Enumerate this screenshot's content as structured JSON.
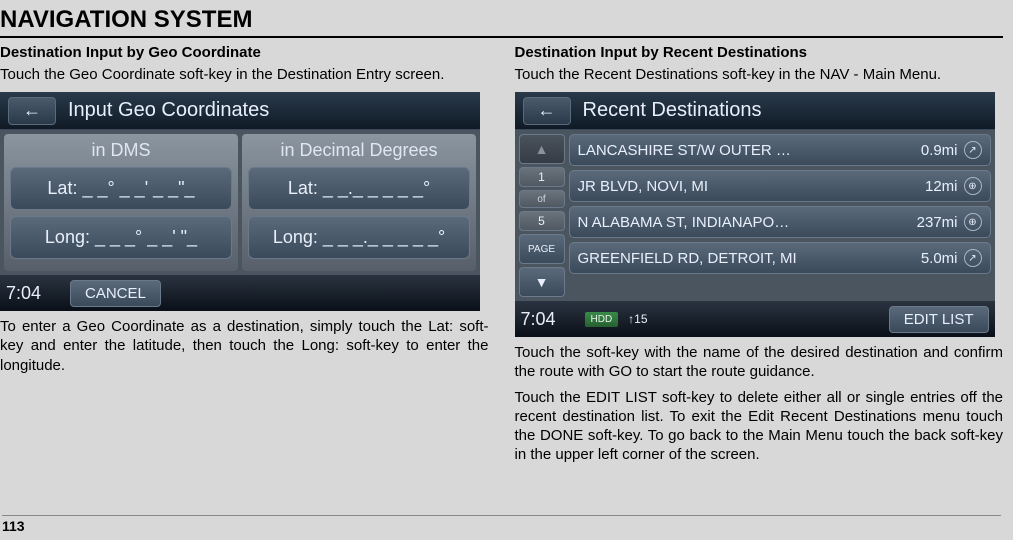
{
  "page_title": "NAVIGATION SYSTEM",
  "page_number": "113",
  "left": {
    "heading": "Destination Input by Geo Coordinate",
    "intro": "Touch the  Geo Coordinate soft-key in the Destination Entry screen.",
    "screen": {
      "back_icon": "←",
      "header_title": "Input Geo Coordinates",
      "dms_title": "in DMS",
      "dec_title": "in Decimal Degrees",
      "dms_lat": "Lat: _ _°  _ _'  _ _\"_",
      "dms_long": "Long: _ _ _°  _ _'   \"_",
      "dec_lat": "Lat: _ _._ _ _ _ _°",
      "dec_long": "Long: _ _ _._ _ _ _ _°",
      "time": "7:04",
      "cancel": "CANCEL"
    },
    "body": "To enter a Geo Coordinate as a destination, simply touch the Lat: soft-key and enter the latitude, then touch the Long: soft-key to enter the longitude."
  },
  "right": {
    "heading": "Destination Input by Recent Destinations",
    "intro": "Touch the Recent Destinations soft-key in the NAV - Main  Menu.",
    "screen": {
      "back_icon": "←",
      "header_title": "Recent Destinations",
      "pager_top": "1",
      "pager_of": "of",
      "pager_bot": "5",
      "pager_page": "PAGE",
      "items": [
        {
          "name": "LANCASHIRE ST/W OUTER …",
          "dist": "0.9mi",
          "icon": "↗"
        },
        {
          "name": "JR BLVD, NOVI, MI",
          "dist": "12mi",
          "icon": "⊕"
        },
        {
          "name": "N ALABAMA ST, INDIANAPO…",
          "dist": "237mi",
          "icon": "⊕"
        },
        {
          "name": "GREENFIELD RD, DETROIT, MI",
          "dist": "5.0mi",
          "icon": "↗"
        }
      ],
      "time": "7:04",
      "hdd": "HDD",
      "temp": "↑15",
      "edit_list": "EDIT LIST"
    },
    "body1": "Touch the soft-key with the name of the desired destination and confirm the route with GO to start the route guidance.",
    "body2": "Touch the EDIT LIST soft-key to delete either all or single entries off the recent destination list. To exit the Edit Recent Destinations menu touch the DONE soft-key. To go back to the Main Menu touch the back soft-key in the upper left corner of the screen."
  }
}
